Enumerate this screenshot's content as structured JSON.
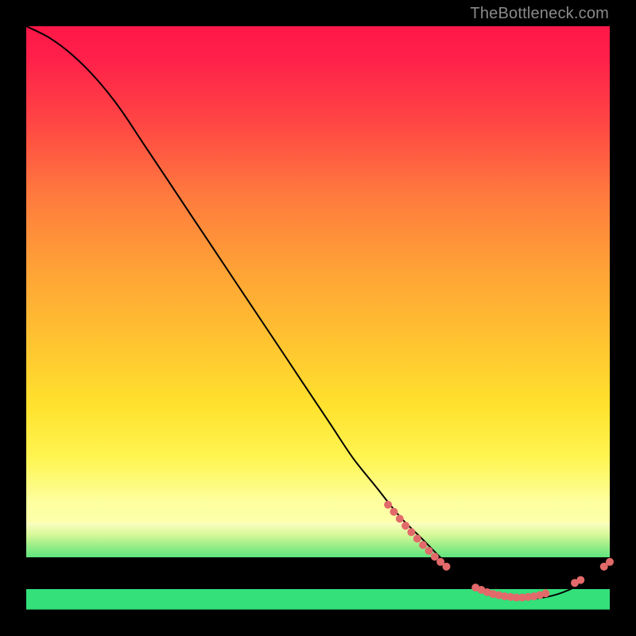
{
  "watermark": "TheBottleneck.com",
  "colors": {
    "curve_stroke": "#000000",
    "dot_fill": "#e26a6a",
    "background": "#000000"
  },
  "chart_data": {
    "type": "line",
    "title": "",
    "xlabel": "",
    "ylabel": "",
    "xlim": [
      0,
      100
    ],
    "ylim": [
      0,
      100
    ],
    "grid": false,
    "legend": false,
    "series": [
      {
        "name": "bottleneck-curve",
        "x": [
          0,
          4,
          8,
          12,
          16,
          20,
          24,
          28,
          32,
          36,
          40,
          44,
          48,
          52,
          56,
          60,
          64,
          68,
          72,
          76,
          80,
          84,
          88,
          92,
          96,
          100
        ],
        "y": [
          100,
          98,
          95,
          91,
          86,
          80,
          74,
          68,
          62,
          56,
          50,
          44,
          38,
          32,
          26,
          21,
          16,
          12,
          8,
          5,
          3,
          2,
          2,
          3,
          5,
          8
        ]
      }
    ],
    "dot_clusters": [
      {
        "name": "descent-cluster",
        "points": [
          {
            "x": 62,
            "y": 18
          },
          {
            "x": 63,
            "y": 16.8
          },
          {
            "x": 64,
            "y": 15.6
          },
          {
            "x": 65,
            "y": 14.4
          },
          {
            "x": 66,
            "y": 13.3
          },
          {
            "x": 67,
            "y": 12.2
          },
          {
            "x": 68,
            "y": 11.1
          },
          {
            "x": 69,
            "y": 10.1
          },
          {
            "x": 70,
            "y": 9.1
          }
        ]
      },
      {
        "name": "descent-tail-pair",
        "points": [
          {
            "x": 71,
            "y": 8.2
          },
          {
            "x": 72,
            "y": 7.4
          }
        ]
      },
      {
        "name": "valley-cluster",
        "points": [
          {
            "x": 77,
            "y": 3.8
          },
          {
            "x": 78,
            "y": 3.4
          },
          {
            "x": 79,
            "y": 3.0
          },
          {
            "x": 80,
            "y": 2.7
          },
          {
            "x": 81,
            "y": 2.5
          },
          {
            "x": 82,
            "y": 2.3
          },
          {
            "x": 83,
            "y": 2.2
          },
          {
            "x": 84,
            "y": 2.1
          },
          {
            "x": 85,
            "y": 2.1
          },
          {
            "x": 86,
            "y": 2.2
          },
          {
            "x": 87,
            "y": 2.3
          },
          {
            "x": 88,
            "y": 2.5
          },
          {
            "x": 89,
            "y": 2.8
          }
        ]
      },
      {
        "name": "ascent-pair-lower",
        "points": [
          {
            "x": 94,
            "y": 4.6
          },
          {
            "x": 95,
            "y": 5.1
          }
        ]
      },
      {
        "name": "ascent-pair-upper",
        "points": [
          {
            "x": 99,
            "y": 7.4
          },
          {
            "x": 100,
            "y": 8.2
          }
        ]
      }
    ]
  }
}
